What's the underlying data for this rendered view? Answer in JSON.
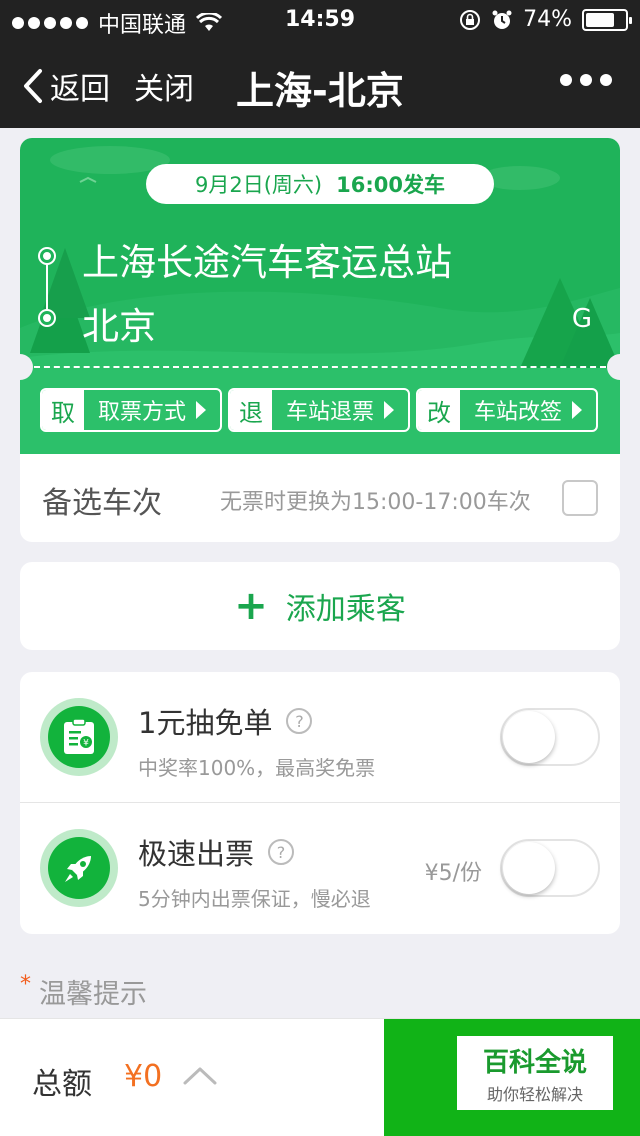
{
  "status_bar": {
    "carrier": "中国联通",
    "time": "14:59",
    "battery": "74%",
    "battery_level": 0.74
  },
  "nav": {
    "back_label": "返回",
    "close_label": "关闭",
    "title": "上海-北京",
    "more_icon": "more-dots-icon"
  },
  "ticket": {
    "date": "9月2日(周六)",
    "departure": "16:00发车",
    "from_station": "上海长途汽车客运总站",
    "to_station": "北京",
    "badge": "G",
    "actions": [
      {
        "key": "取",
        "label": "取票方式"
      },
      {
        "key": "退",
        "label": "车站退票"
      },
      {
        "key": "改",
        "label": "车站改签"
      }
    ],
    "colors": {
      "primary": "#1fb35a"
    }
  },
  "alternate": {
    "title": "备选车次",
    "description": "无票时更换为15:00-17:00车次",
    "checked": false
  },
  "add_passenger": {
    "icon": "+",
    "label": "添加乘客"
  },
  "services": [
    {
      "title": "1元抽免单",
      "help": "?",
      "description": "中奖率100%，最高奖免票",
      "price": "",
      "enabled": false,
      "icon": "voucher-icon"
    },
    {
      "title": "极速出票",
      "help": "?",
      "description": "5分钟内出票保证，慢必退",
      "price": "¥5/份",
      "enabled": false,
      "icon": "rocket-icon"
    }
  ],
  "tips": {
    "marker": "*",
    "label": "温馨提示"
  },
  "footer": {
    "total_label": "总额",
    "total_value": "¥0",
    "button_color": "#11b317"
  },
  "watermark": {
    "main": "百科全说",
    "sub": "助你轻松解决"
  }
}
